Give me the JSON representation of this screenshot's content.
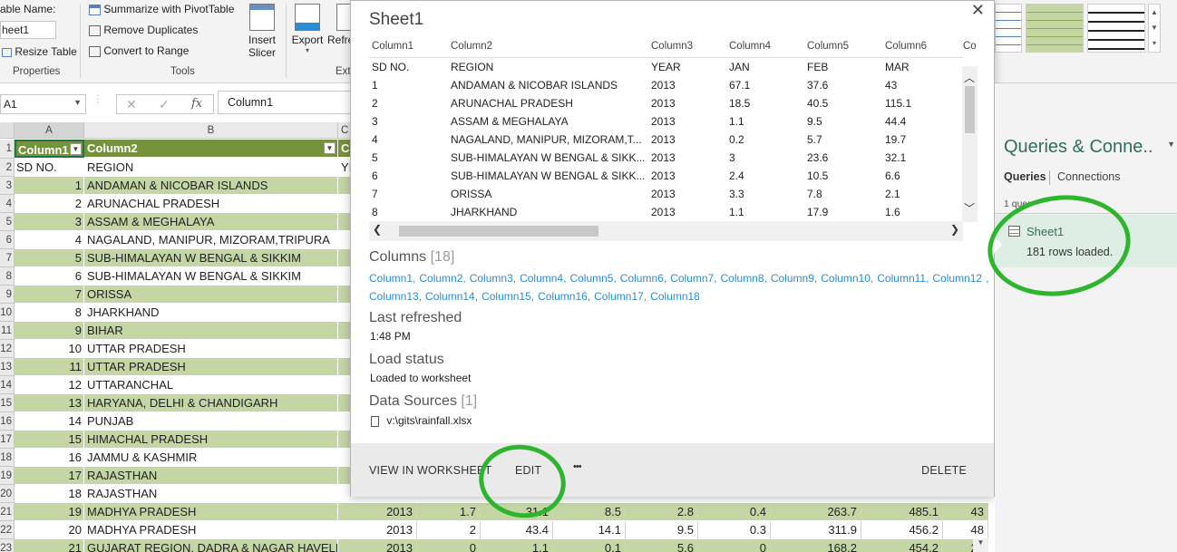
{
  "ribbon": {
    "table_name_label": "able Name:",
    "table_name_value": "heet1",
    "resize_table": "Resize Table",
    "properties_label": "Properties",
    "summarize_pivot": "Summarize with PivotTable",
    "remove_duplicates": "Remove Duplicates",
    "convert_to_range": "Convert to Range",
    "tools_label": "Tools",
    "insert_slicer_1": "Insert",
    "insert_slicer_2": "Slicer",
    "export": "Export",
    "refresh": "Refre",
    "ext_label": "Ext"
  },
  "formula_bar": {
    "name_box": "A1",
    "fx": "fx",
    "content": "Column1"
  },
  "grid": {
    "col_headers": [
      "A",
      "B",
      "C"
    ],
    "header_row": {
      "col1": "Column1",
      "col2": "Column2",
      "col3": "C"
    },
    "row2": {
      "col1": "SD NO.",
      "col2": "REGION",
      "col3": "YI"
    },
    "rows": [
      {
        "rn": "3",
        "sd": "1",
        "region": "ANDAMAN & NICOBAR ISLANDS"
      },
      {
        "rn": "4",
        "sd": "2",
        "region": "ARUNACHAL PRADESH"
      },
      {
        "rn": "5",
        "sd": "3",
        "region": "ASSAM & MEGHALAYA"
      },
      {
        "rn": "6",
        "sd": "4",
        "region": "NAGALAND, MANIPUR, MIZORAM,TRIPURA"
      },
      {
        "rn": "7",
        "sd": "5",
        "region": "SUB-HIMALAYAN W BENGAL & SIKKIM"
      },
      {
        "rn": "8",
        "sd": "6",
        "region": "SUB-HIMALAYAN W BENGAL & SIKKIM"
      },
      {
        "rn": "9",
        "sd": "7",
        "region": "ORISSA"
      },
      {
        "rn": "10",
        "sd": "8",
        "region": "JHARKHAND"
      },
      {
        "rn": "11",
        "sd": "9",
        "region": "BIHAR"
      },
      {
        "rn": "12",
        "sd": "10",
        "region": "UTTAR PRADESH"
      },
      {
        "rn": "13",
        "sd": "11",
        "region": "UTTAR PRADESH"
      },
      {
        "rn": "14",
        "sd": "12",
        "region": "UTTARANCHAL"
      },
      {
        "rn": "15",
        "sd": "13",
        "region": "HARYANA, DELHI & CHANDIGARH"
      },
      {
        "rn": "16",
        "sd": "14",
        "region": "PUNJAB"
      },
      {
        "rn": "17",
        "sd": "15",
        "region": "HIMACHAL PRADESH"
      },
      {
        "rn": "18",
        "sd": "16",
        "region": "JAMMU & KASHMIR"
      },
      {
        "rn": "19",
        "sd": "17",
        "region": "RAJASTHAN"
      },
      {
        "rn": "20",
        "sd": "18",
        "region": "RAJASTHAN"
      },
      {
        "rn": "21",
        "sd": "19",
        "region": "MADHYA PRADESH",
        "v": [
          "2013",
          "1.7",
          "31.1",
          "8.5",
          "2.8",
          "0.4",
          "263.7",
          "485.1",
          "43"
        ]
      },
      {
        "rn": "22",
        "sd": "20",
        "region": "MADHYA PRADESH",
        "v": [
          "2013",
          "2",
          "43.4",
          "14.1",
          "9.5",
          "0.3",
          "311.9",
          "456.2",
          "48"
        ]
      },
      {
        "rn": "23",
        "sd": "21",
        "region": "GUJARAT REGION, DADRA & NAGAR HAVELI",
        "v": [
          "2013",
          "0",
          "1.1",
          "0.1",
          "5.6",
          "0",
          "168.2",
          "454.2",
          "28"
        ]
      }
    ]
  },
  "popup": {
    "title": "Sheet1",
    "preview_headers": [
      "Column1",
      "Column2",
      "Column3",
      "Column4",
      "Column5",
      "Column6",
      "Co"
    ],
    "preview_rows": [
      [
        "SD NO.",
        "REGION",
        "YEAR",
        "JAN",
        "FEB",
        "MAR"
      ],
      [
        "1",
        "ANDAMAN & NICOBAR ISLANDS",
        "2013",
        "67.1",
        "37.6",
        "43"
      ],
      [
        "2",
        "ARUNACHAL PRADESH",
        "2013",
        "18.5",
        "40.5",
        "115.1"
      ],
      [
        "3",
        "ASSAM & MEGHALAYA",
        "2013",
        "1.1",
        "9.5",
        "44.4"
      ],
      [
        "4",
        "NAGALAND, MANIPUR, MIZORAM,T...",
        "2013",
        "0.2",
        "5.7",
        "19.7"
      ],
      [
        "5",
        "SUB-HIMALAYAN W BENGAL & SIKK...",
        "2013",
        "3",
        "23.6",
        "32.1"
      ],
      [
        "6",
        "SUB-HIMALAYAN W BENGAL & SIKK...",
        "2013",
        "2.4",
        "10.5",
        "6.6"
      ],
      [
        "7",
        "ORISSA",
        "2013",
        "3.3",
        "7.8",
        "2.1"
      ],
      [
        "8",
        "JHARKHAND",
        "2013",
        "1.1",
        "17.9",
        "1.6"
      ]
    ],
    "columns_label": "Columns",
    "columns_count": "[18]",
    "column_links": [
      "Column1,",
      "Column2,",
      "Column3,",
      "Column4,",
      "Column5,",
      "Column6,",
      "Column7,",
      "Column8,",
      "Column9,",
      "Column10,",
      "Column11,",
      "Column12",
      ", Column13,",
      "Column14,",
      "Column15,",
      "Column16,",
      "Column17,",
      "Column18"
    ],
    "last_refreshed_label": "Last refreshed",
    "last_refreshed_value": "1:48 PM",
    "load_status_label": "Load status",
    "load_status_value": "Loaded to worksheet",
    "data_sources_label": "Data Sources",
    "data_sources_count": "[1]",
    "data_source_path": "v:\\gits\\rainfall.xlsx",
    "view_in_worksheet": "VIEW IN WORKSHEET",
    "edit": "EDIT",
    "more": "•••",
    "delete": "DELETE"
  },
  "queries_pane": {
    "title": "Queries & Conne..",
    "tab_queries": "Queries",
    "tab_connections": "Connections",
    "query_count": "1 quer",
    "query_name": "Sheet1",
    "query_status": "181 rows loaded."
  },
  "colors": {
    "table_header_green": "#76923c",
    "table_band_green": "#c4d6a4",
    "pane_title_green": "#2f6e5a",
    "link_blue": "#2a8dd4",
    "annotation_green": "#2db52d"
  }
}
